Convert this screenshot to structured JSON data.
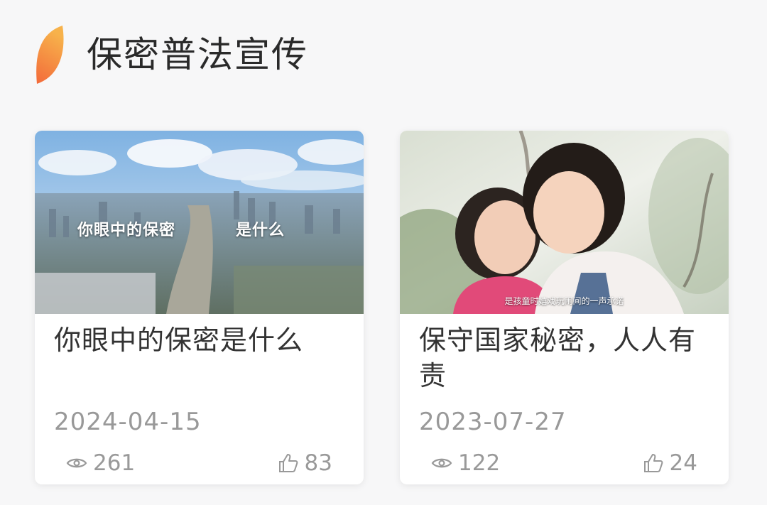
{
  "section": {
    "title": "保密普法宣传",
    "accent_colors": [
      "#f26a3b",
      "#f7b04a"
    ]
  },
  "cards": [
    {
      "title": "你眼中的保密是什么",
      "date": "2024-04-15",
      "views": "261",
      "likes": "83",
      "thumb_text_left": "你眼中的保密",
      "thumb_text_right": "是什么"
    },
    {
      "title": "保守国家秘密，人人有责",
      "date": "2023-07-27",
      "views": "122",
      "likes": "24",
      "thumb_caption": "是孩童时嬉戏玩闹间的一声承诺"
    }
  ]
}
